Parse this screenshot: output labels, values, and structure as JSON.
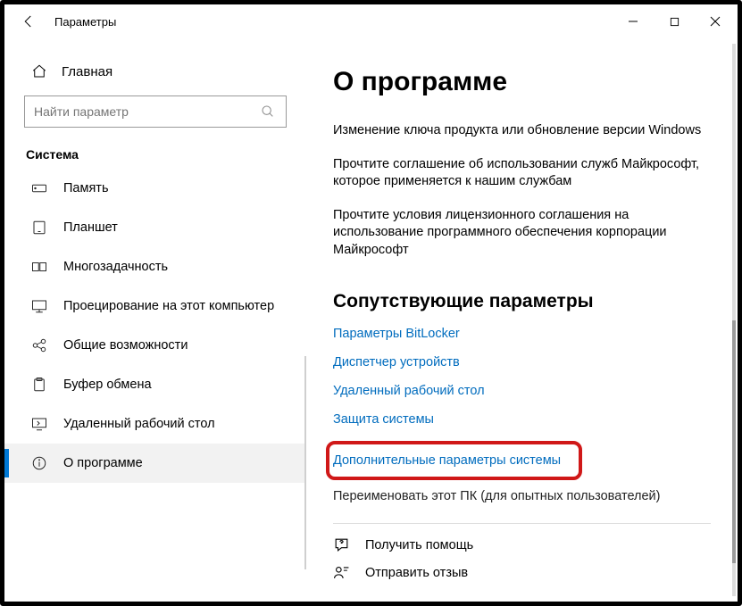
{
  "window": {
    "title": "Параметры"
  },
  "sidebar": {
    "home": "Главная",
    "search_placeholder": "Найти параметр",
    "group": "Система",
    "items": [
      {
        "label": "Память"
      },
      {
        "label": "Планшет"
      },
      {
        "label": "Многозадачность"
      },
      {
        "label": "Проецирование на этот компьютер"
      },
      {
        "label": "Общие возможности"
      },
      {
        "label": "Буфер обмена"
      },
      {
        "label": "Удаленный рабочий стол"
      },
      {
        "label": "О программе"
      }
    ]
  },
  "main": {
    "heading": "О программе",
    "p1": "Изменение ключа продукта или обновление версии Windows",
    "p2": "Прочтите соглашение об использовании служб Майкрософт, которое применяется к нашим службам",
    "p3": "Прочтите условия лицензионного соглашения на использование программного обеспечения корпорации Майкрософт",
    "related_heading": "Сопутствующие параметры",
    "links": [
      "Параметры BitLocker",
      "Диспетчер устройств",
      "Удаленный рабочий стол",
      "Защита системы",
      "Дополнительные параметры системы",
      "Переименовать этот ПК (для опытных пользователей)"
    ],
    "help": "Получить помощь",
    "feedback": "Отправить отзыв"
  }
}
